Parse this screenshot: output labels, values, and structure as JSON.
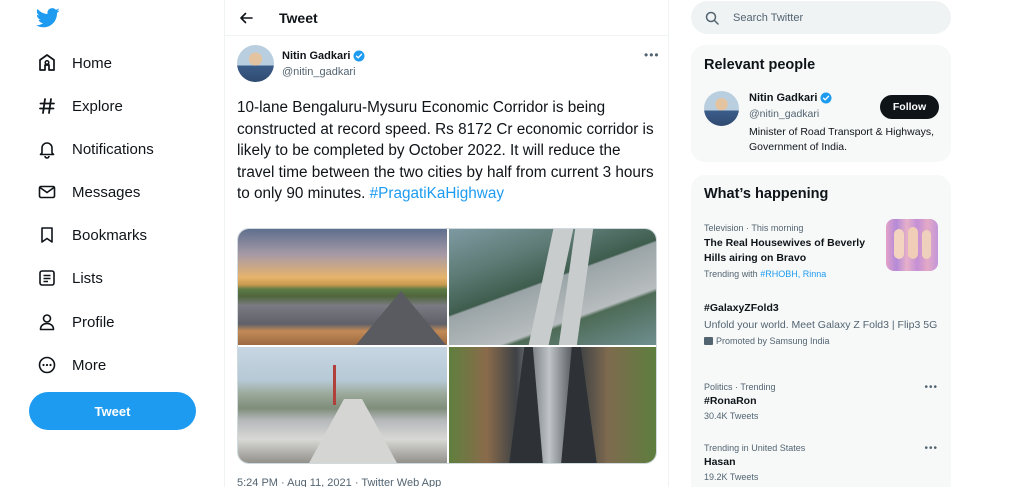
{
  "nav": {
    "items": [
      {
        "label": "Home",
        "icon": "home-icon"
      },
      {
        "label": "Explore",
        "icon": "hashtag-icon"
      },
      {
        "label": "Notifications",
        "icon": "bell-icon"
      },
      {
        "label": "Messages",
        "icon": "envelope-icon"
      },
      {
        "label": "Bookmarks",
        "icon": "bookmark-icon"
      },
      {
        "label": "Lists",
        "icon": "list-icon"
      },
      {
        "label": "Profile",
        "icon": "person-icon"
      },
      {
        "label": "More",
        "icon": "more-circle-icon"
      }
    ],
    "tweet_button": "Tweet",
    "brand_color": "#1d9bf0"
  },
  "header": {
    "title": "Tweet"
  },
  "tweet": {
    "author_name": "Nitin Gadkari",
    "author_handle": "@nitin_gadkari",
    "text": "10-lane Bengaluru-Mysuru Economic Corridor is being constructed at record speed. Rs 8172 Cr economic corridor is likely to be completed by October 2022. It will reduce the travel time between the two cities by half from current 3 hours to only 90 minutes. ",
    "hashtag": "#PragatiKaHighway",
    "meta": "5:24 PM · Aug 11, 2021 · Twitter Web App"
  },
  "search": {
    "placeholder": "Search Twitter"
  },
  "relevant_people": {
    "title": "Relevant people",
    "name": "Nitin Gadkari",
    "handle": "@nitin_gadkari",
    "bio": "Minister of Road Transport & Highways, Government of India.",
    "follow_label": "Follow"
  },
  "whats_happening": {
    "title": "What’s happening",
    "trends": [
      {
        "context": "Television · This morning",
        "title": "The Real Housewives of Beverly Hills airing on Bravo",
        "sub_prefix": "Trending with ",
        "sub_link": "#RHOBH, Rinna"
      },
      {
        "title": "#GalaxyZFold3",
        "desc": "Unfold your world. Meet Galaxy Z Fold3 | Flip3 5G",
        "promo": "Promoted by Samsung India"
      },
      {
        "context": "Politics · Trending",
        "title": "#RonaRon",
        "count": "30.4K Tweets"
      },
      {
        "context": "Trending in United States",
        "title": "Hasan",
        "count": "19.2K Tweets"
      }
    ]
  }
}
